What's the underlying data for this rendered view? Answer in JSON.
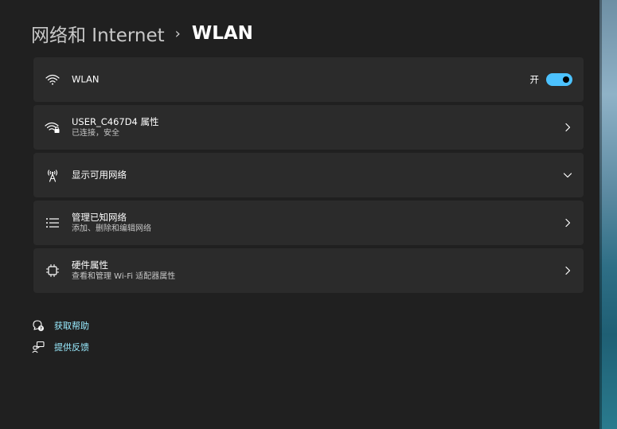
{
  "header": {
    "parent": "网络和 Internet",
    "separator": "›",
    "current": "WLAN"
  },
  "rows": [
    {
      "id": "wlan",
      "icon": "wifi-icon",
      "title": "WLAN",
      "subtitle": "",
      "toggle": {
        "label": "开",
        "on": true
      }
    },
    {
      "id": "properties",
      "icon": "wifi-lock-icon",
      "title": "USER_C467D4 属性",
      "subtitle": "已连接，安全",
      "control": "chevron-right"
    },
    {
      "id": "show-networks",
      "icon": "antenna-icon",
      "title": "显示可用网络",
      "subtitle": "",
      "control": "chevron-down"
    },
    {
      "id": "manage-networks",
      "icon": "list-icon",
      "title": "管理已知网络",
      "subtitle": "添加、删除和编辑网络",
      "control": "chevron-right"
    },
    {
      "id": "hardware",
      "icon": "chip-icon",
      "title": "硬件属性",
      "subtitle": "查看和管理 Wi-Fi 适配器属性",
      "control": "chevron-right"
    }
  ],
  "links": [
    {
      "icon": "help-icon",
      "label": "获取帮助"
    },
    {
      "icon": "feedback-icon",
      "label": "提供反馈"
    }
  ],
  "colors": {
    "background": "#202020",
    "card": "#2b2b2b",
    "accent": "#4cc2ff",
    "link": "#99ebff"
  }
}
